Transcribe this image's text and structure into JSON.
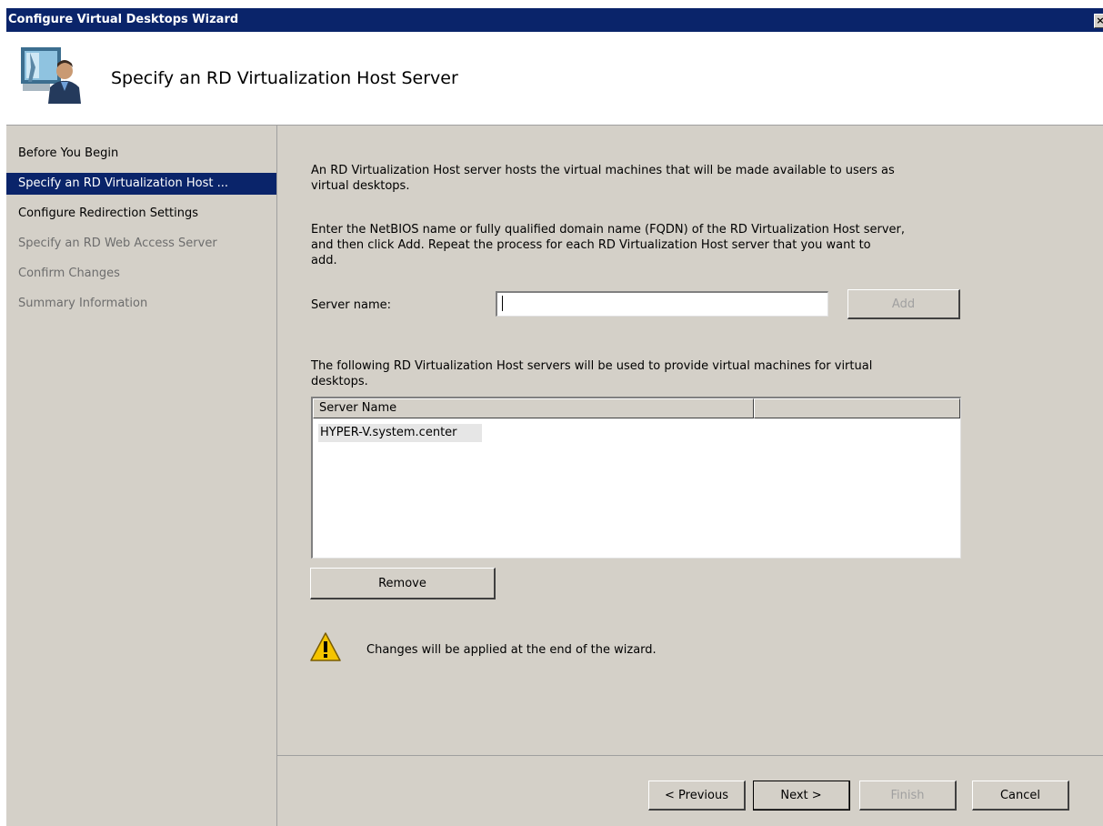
{
  "window": {
    "title": "Configure Virtual Desktops Wizard",
    "close_glyph": "×",
    "title_bar_color": "#0a246a"
  },
  "header": {
    "title": "Specify an RD Virtualization Host Server",
    "icon": "wizard-person-monitor-icon"
  },
  "nav": {
    "items": [
      {
        "label": "Before You Begin",
        "state": "enabled"
      },
      {
        "label": "Specify an RD Virtualization Host ...",
        "state": "active"
      },
      {
        "label": "Configure Redirection Settings",
        "state": "enabled"
      },
      {
        "label": "Specify an RD Web Access Server",
        "state": "disabled"
      },
      {
        "label": "Confirm Changes",
        "state": "disabled"
      },
      {
        "label": "Summary Information",
        "state": "disabled"
      }
    ]
  },
  "main": {
    "intro_line1": "An RD Virtualization Host server hosts the virtual machines that will be made available to users as",
    "intro_line2": "virtual desktops.",
    "instructions_line1": "Enter the NetBIOS name or fully qualified domain name (FQDN) of the RD Virtualization Host server,",
    "instructions_line2": "and then click Add. Repeat the process for each RD Virtualization Host server that you want to",
    "instructions_line3": "add.",
    "server_name_label": "Server name:",
    "server_name_value": "",
    "add_label": "Add",
    "list_caption_line1": "The following RD Virtualization Host servers will be used to provide virtual machines for virtual",
    "list_caption_line2": "desktops.",
    "list_columns": [
      "Server Name",
      ""
    ],
    "list_rows": [
      "HYPER-V.system.center"
    ],
    "remove_label": "Remove",
    "warning_text": "Changes will be applied at the end of the wizard.",
    "warning_icon": "warning-icon"
  },
  "footer": {
    "previous_label": "< Previous",
    "next_label": "Next >",
    "finish_label": "Finish",
    "cancel_label": "Cancel"
  }
}
